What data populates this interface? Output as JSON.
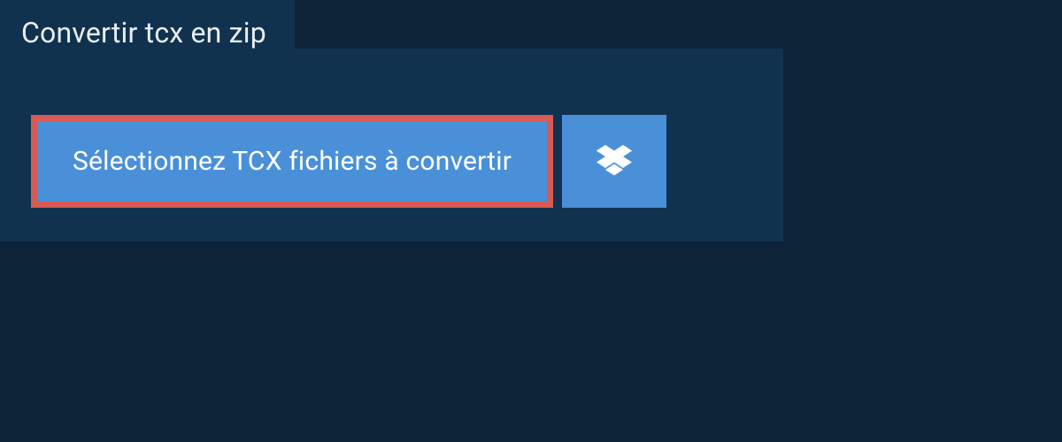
{
  "tab": {
    "label": "Convertir tcx en zip"
  },
  "buttons": {
    "select_files": "Sélectionnez TCX fichiers à convertir",
    "dropbox_icon_name": "dropbox"
  },
  "colors": {
    "background": "#0d2438",
    "panel": "#11324f",
    "button_bg": "#4a90d9",
    "button_border": "#d85a54",
    "text_light": "#e8eef4",
    "text_white": "#ffffff"
  }
}
